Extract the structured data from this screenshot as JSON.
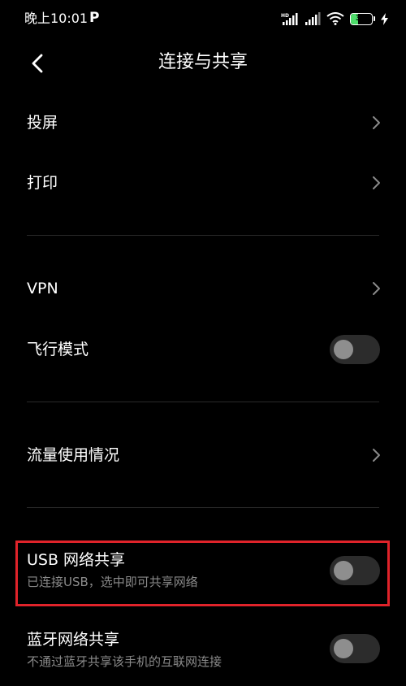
{
  "status_bar": {
    "time": "晚上10:01",
    "p_badge": "P",
    "battery_level": "34",
    "battery_color": "#4ddc6a"
  },
  "header": {
    "title": "连接与共享"
  },
  "items": {
    "cast": {
      "label": "投屏"
    },
    "print": {
      "label": "打印"
    },
    "vpn": {
      "label": "VPN"
    },
    "airplane": {
      "label": "飞行模式",
      "enabled": false
    },
    "data_usage": {
      "label": "流量使用情况"
    },
    "usb_tethering": {
      "label": "USB 网络共享",
      "subtitle": "已连接USB，选中即可共享网络",
      "enabled": false
    },
    "bt_tethering": {
      "label": "蓝牙网络共享",
      "subtitle": "不通过蓝牙共享该手机的互联网连接",
      "enabled": false
    }
  },
  "colors": {
    "background": "#000000",
    "highlight": "#e0232a",
    "subtitle": "#8a8a8a"
  }
}
